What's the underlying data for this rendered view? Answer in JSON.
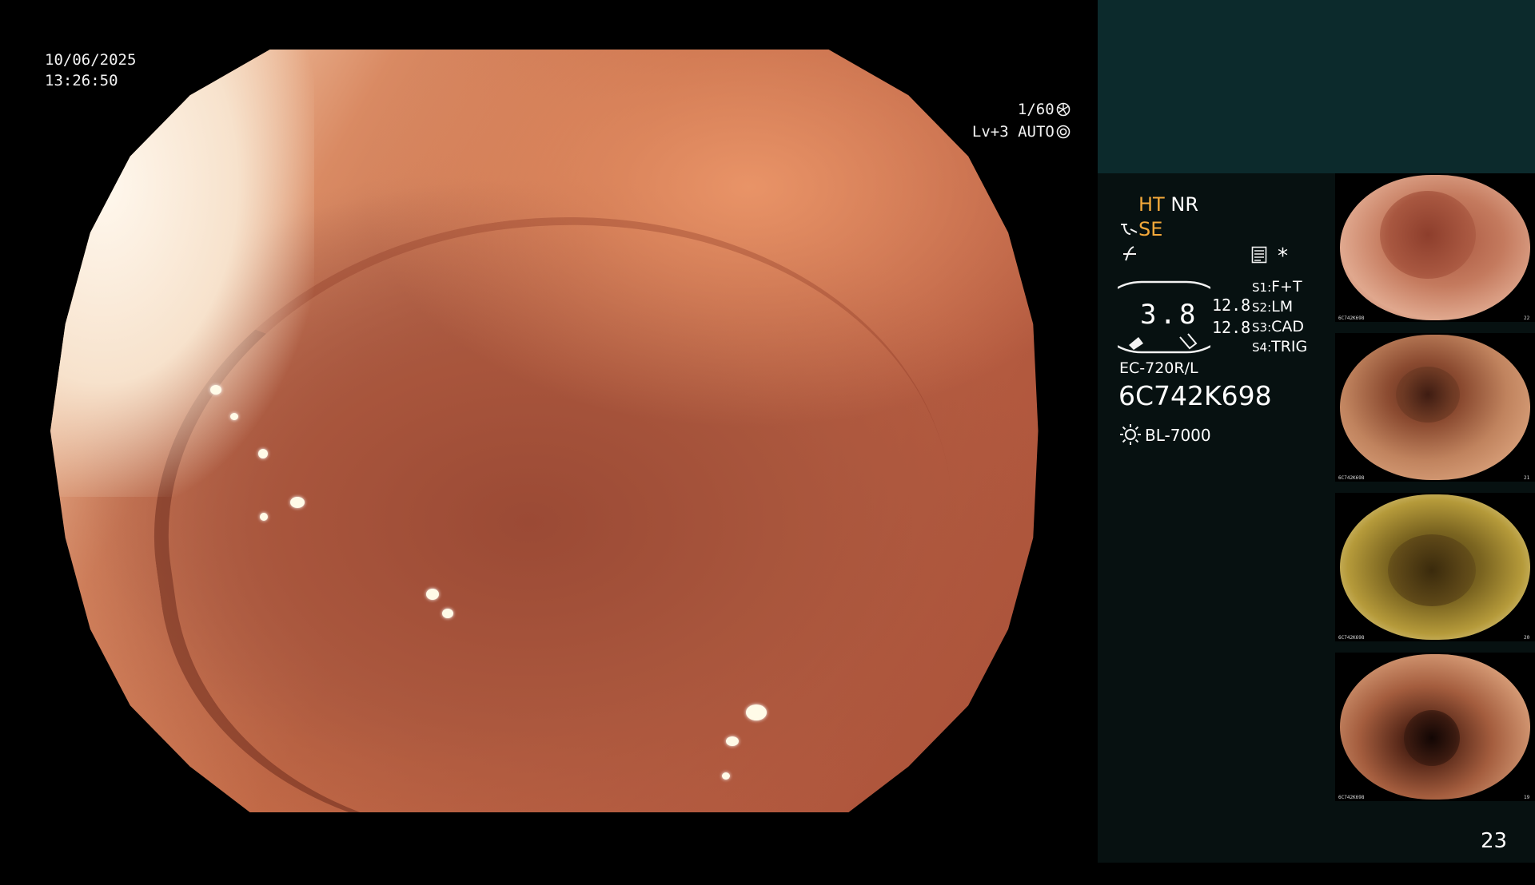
{
  "overlay": {
    "date": "10/06/2025",
    "time": "13:26:50",
    "shutter": "1/60",
    "level_auto": "Lv+3 AUTO"
  },
  "status": {
    "ht": "HT",
    "nr": "NR",
    "se": "SE",
    "gauge_value": "3.8",
    "value_1": "12.8",
    "value_2": "12.8",
    "s1_label": "S1:",
    "s1_value": "F+T",
    "s2_label": "S2:",
    "s2_value": "LM",
    "s3_label": "S3:",
    "s3_value": "CAD",
    "s4_label": "S4:",
    "s4_value": "TRIG",
    "scope_model": "EC-720R/L",
    "scope_serial": "6C742K698",
    "light_source": "BL-7000",
    "asterisk": "*"
  },
  "thumbnails": [
    {
      "serial": "6C742K698",
      "number": "22"
    },
    {
      "serial": "6C742K698",
      "number": "21"
    },
    {
      "serial": "6C742K698",
      "number": "20"
    },
    {
      "serial": "6C742K698",
      "number": "19"
    }
  ],
  "image_count": "23",
  "icons": {
    "shutter": "aperture-icon",
    "auto": "iris-icon",
    "gauge": "zoom-gauge-icon",
    "light": "light-icon",
    "enhance": "enhance-icon",
    "filter": "filter-icon",
    "menu": "menu-icon"
  }
}
